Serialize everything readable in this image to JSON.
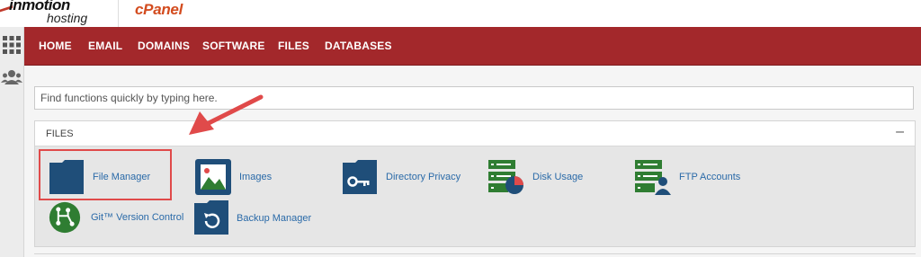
{
  "header": {
    "brand_name": "inmotion",
    "brand_sub": "hosting",
    "product_name": "cPanel"
  },
  "sidebar": {
    "icons": [
      "grid-icon",
      "users-icon"
    ]
  },
  "nav": {
    "items": [
      {
        "label": "HOME"
      },
      {
        "label": "EMAIL"
      },
      {
        "label": "DOMAINS"
      },
      {
        "label": "SOFTWARE"
      },
      {
        "label": "FILES"
      },
      {
        "label": "DATABASES"
      }
    ]
  },
  "search": {
    "placeholder": "Find functions quickly by typing here."
  },
  "files_panel": {
    "title": "FILES",
    "collapse_symbol": "–",
    "tools": [
      {
        "label": "File Manager",
        "icon": "folder-icon"
      },
      {
        "label": "Images",
        "icon": "image-icon"
      },
      {
        "label": "Directory Privacy",
        "icon": "folder-key-icon"
      },
      {
        "label": "Disk Usage",
        "icon": "disk-usage-icon"
      },
      {
        "label": "FTP Accounts",
        "icon": "ftp-accounts-icon"
      },
      {
        "label": "Git™ Version Control",
        "icon": "git-icon"
      },
      {
        "label": "Backup Manager",
        "icon": "backup-icon"
      }
    ]
  },
  "colors": {
    "nav_background": "#a3282b",
    "link": "#2a6aa8",
    "icon_navy": "#1f4e79",
    "icon_green": "#2f7d32",
    "annotation_red": "#e04a4a"
  }
}
